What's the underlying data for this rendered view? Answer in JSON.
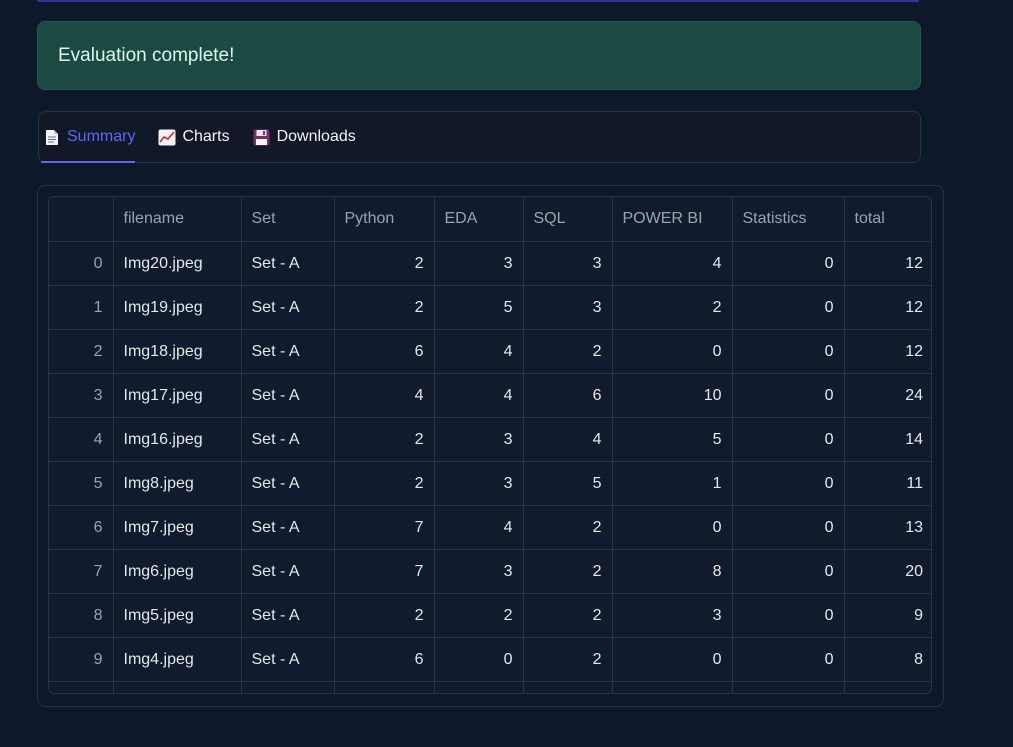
{
  "alert": {
    "message": "Evaluation complete!"
  },
  "tabs": [
    {
      "label": "Summary",
      "icon": "page-icon",
      "active": true
    },
    {
      "label": "Charts",
      "icon": "chart-icon",
      "active": false
    },
    {
      "label": "Downloads",
      "icon": "floppy-disk-icon",
      "active": false
    }
  ],
  "table": {
    "columns": [
      "",
      "filename",
      "Set",
      "Python",
      "EDA",
      "SQL",
      "POWER BI",
      "Statistics",
      "total"
    ],
    "rows": [
      [
        "0",
        "Img20.jpeg",
        "Set - A",
        "2",
        "3",
        "3",
        "4",
        "0",
        "12"
      ],
      [
        "1",
        "Img19.jpeg",
        "Set - A",
        "2",
        "5",
        "3",
        "2",
        "0",
        "12"
      ],
      [
        "2",
        "Img18.jpeg",
        "Set - A",
        "6",
        "4",
        "2",
        "0",
        "0",
        "12"
      ],
      [
        "3",
        "Img17.jpeg",
        "Set - A",
        "4",
        "4",
        "6",
        "10",
        "0",
        "24"
      ],
      [
        "4",
        "Img16.jpeg",
        "Set - A",
        "2",
        "3",
        "4",
        "5",
        "0",
        "14"
      ],
      [
        "5",
        "Img8.jpeg",
        "Set - A",
        "2",
        "3",
        "5",
        "1",
        "0",
        "11"
      ],
      [
        "6",
        "Img7.jpeg",
        "Set - A",
        "7",
        "4",
        "2",
        "0",
        "0",
        "13"
      ],
      [
        "7",
        "Img6.jpeg",
        "Set - A",
        "7",
        "3",
        "2",
        "8",
        "0",
        "20"
      ],
      [
        "8",
        "Img5.jpeg",
        "Set - A",
        "2",
        "2",
        "2",
        "3",
        "0",
        "9"
      ],
      [
        "9",
        "Img4.jpeg",
        "Set - A",
        "6",
        "0",
        "2",
        "0",
        "0",
        "8"
      ]
    ]
  },
  "colors": {
    "background": "#0f172a",
    "success_bg": "#1b4a43",
    "accent": "#6366f1"
  }
}
